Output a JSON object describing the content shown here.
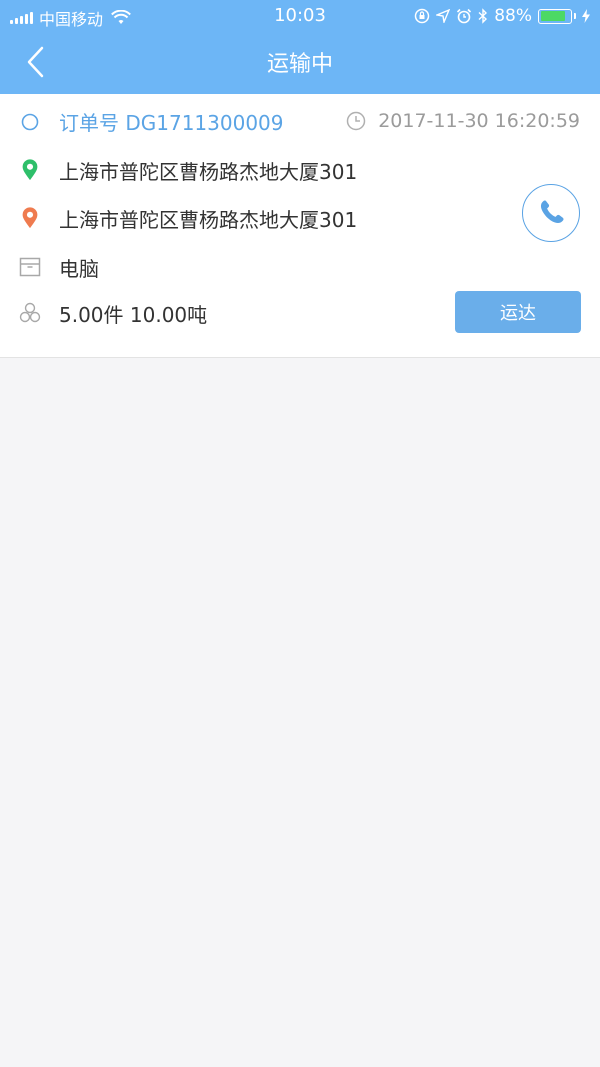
{
  "status_bar": {
    "carrier": "中国移动",
    "time": "10:03",
    "battery_text": "88%",
    "battery_level": 0.88,
    "battery_color": "#4cd964"
  },
  "nav": {
    "title": "运输中",
    "back_icon": "chevron-left-icon"
  },
  "order": {
    "number_label": "订单号 DG1711300009",
    "datetime": "2017-11-30 16:20:59",
    "origin_address": "上海市普陀区曹杨路杰地大厦301",
    "destination_address": "上海市普陀区曹杨路杰地大厦301",
    "goods": "电脑",
    "quantity_weight": "5.00件  10.00吨"
  },
  "actions": {
    "deliver_label": "运达",
    "call_icon": "phone-icon"
  },
  "colors": {
    "header": "#6db6f6",
    "accent": "#5ba4e5",
    "origin_pin": "#2ebf6a",
    "destination_pin": "#ef7b4f",
    "button": "#6aaeea"
  }
}
